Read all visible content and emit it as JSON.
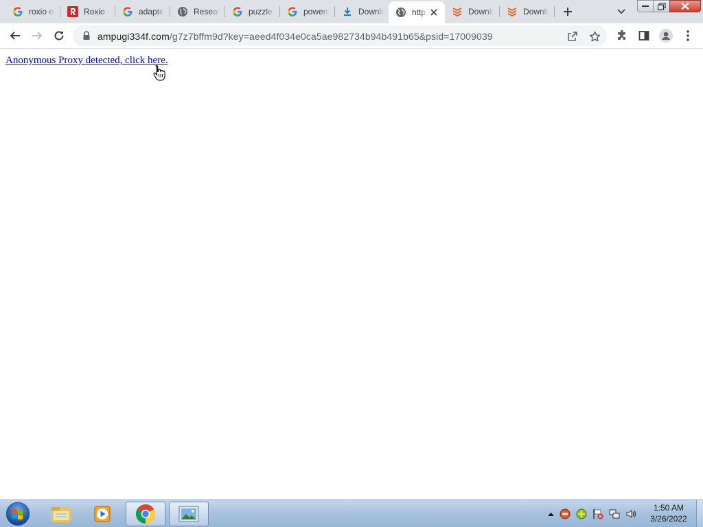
{
  "browser": {
    "tabs": [
      {
        "title": "roxio easy",
        "favicon": "google-icon"
      },
      {
        "title": "Roxio -",
        "favicon": "roxio-icon"
      },
      {
        "title": "adapter",
        "favicon": "google-icon"
      },
      {
        "title": "Research",
        "favicon": "globe-icon"
      },
      {
        "title": "puzzle",
        "favicon": "google-icon"
      },
      {
        "title": "powerdvd",
        "favicon": "google-icon"
      },
      {
        "title": "Download",
        "favicon": "download-icon"
      },
      {
        "title": "http",
        "favicon": "globe-icon",
        "active": true
      },
      {
        "title": "Download",
        "favicon": "stack-icon"
      },
      {
        "title": "Download",
        "favicon": "stack-icon"
      }
    ],
    "address": {
      "domain": "ampugi334f.com",
      "path": "/g7z7bffm9d?key=aeed4f034e0ca5ae982734b94b491b65&psid=17009039"
    }
  },
  "page": {
    "link_text": "Anonymous Proxy detected, click here."
  },
  "taskbar": {
    "time": "1:50 AM",
    "date": "3/26/2022"
  },
  "colors": {
    "link": "#0000ee",
    "tabstrip": "#dee1e6",
    "omnibox": "#f1f3f4",
    "taskbar": "#a9c3df"
  }
}
